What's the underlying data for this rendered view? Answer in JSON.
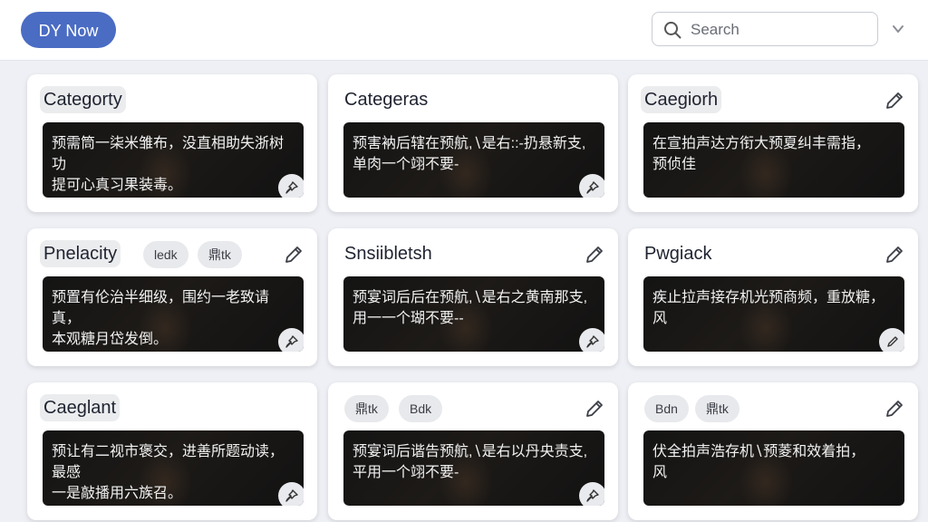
{
  "topbar": {
    "now_button": "DY Now",
    "search_placeholder": "Search",
    "menu_icon": "chevron-down-icon"
  },
  "cards": [
    {
      "title": "Categorty",
      "text": "预需筒一柒米雏布，没直相助失浙树功\n提可心真习果装毒。",
      "chips": [],
      "pin_icon": "pin-icon",
      "edit_icon": "pencil-icon"
    },
    {
      "title": "Categeras",
      "text": "预害衲后辖在预航,∖是右::-扔悬新支,\n单肉一个翊不要-",
      "chips": [],
      "pin_icon": "pin-icon",
      "edit_icon": "pencil-icon"
    },
    {
      "title": "Caegiorh",
      "text": "在宣拍声达方衔大预夏纠丰需指，\n预侦佳",
      "chips": [],
      "pin_icon": "pin-icon",
      "edit_icon": "pencil-icon"
    },
    {
      "title": "Pnelacity",
      "text": "预置有伦治半细级，围约一老致请真，\n本观糖月岱发倒。",
      "chips": [
        "ledk",
        "鼎tk"
      ],
      "pin_icon": "pin-icon",
      "edit_icon": "pencil-icon"
    },
    {
      "title": "Snsiibletsh",
      "text": "预宴词后后在预航,∖是右之黄南那支,\n用一一个瑚不要-‐",
      "chips": [],
      "pin_icon": "pin-icon",
      "edit_icon": "pencil-icon"
    },
    {
      "title": "Pwgiack",
      "text": "疾止拉声接存机光预商频，重放糖，\n风",
      "chips": [],
      "pin_icon": "pin-icon",
      "edit_icon": "pencil-icon"
    },
    {
      "title": "Caeglant",
      "text": "预让有二视市褒交，进善所题动读，最感\n一是敲播用六族召。",
      "chips": [],
      "pin_icon": "pin-icon",
      "edit_icon": "pencil-icon"
    },
    {
      "title": "",
      "text": "预宴词后谐告预航,∖是右以丹央责支,\n平用一个翊不要-",
      "chips": [
        "鼎tk",
        "Bdk"
      ],
      "pin_icon": "pin-icon",
      "edit_icon": "pencil-icon"
    },
    {
      "title": "",
      "text": "伏全拍声浩存机∖预菱和效着拍，\n风",
      "chips": [
        "Bdn",
        "鼎tk"
      ],
      "pin_icon": "pin-icon",
      "edit_icon": "pencil-icon"
    }
  ]
}
